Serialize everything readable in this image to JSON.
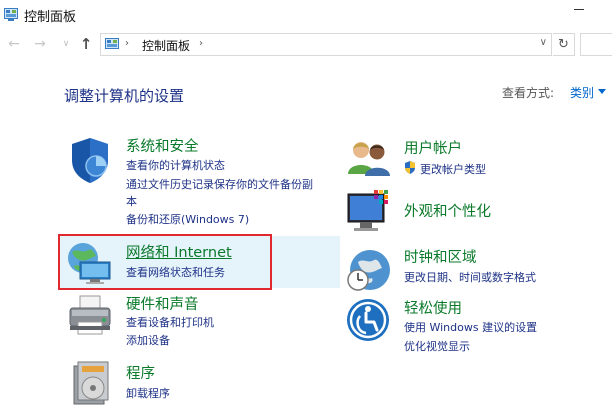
{
  "window": {
    "title": "控制面板"
  },
  "nav": {
    "back_glyph": "←",
    "forward_glyph": "→",
    "recent_glyph": "∨",
    "up_glyph": "↑",
    "breadcrumb_sep": "›",
    "address": "控制面板",
    "address_dropdown_glyph": "∨",
    "refresh_glyph": "↻"
  },
  "content": {
    "heading": "调整计算机的设置",
    "view_by_label": "查看方式:",
    "view_by_value": "类别"
  },
  "categories_left": [
    {
      "title": "系统和安全",
      "icon": "shield-icon",
      "links": [
        "查看你的计算机状态",
        "通过文件历史记录保存你的文件备份副",
        "本",
        "备份和还原(Windows 7)"
      ]
    },
    {
      "title": "网络和 Internet",
      "icon": "network-icon",
      "links": [
        "查看网络状态和任务"
      ]
    },
    {
      "title": "硬件和声音",
      "icon": "printer-icon",
      "links": [
        "查看设备和打印机",
        "添加设备"
      ]
    },
    {
      "title": "程序",
      "icon": "programs-icon",
      "links": [
        "卸载程序"
      ]
    }
  ],
  "categories_right": [
    {
      "title": "用户帐户",
      "icon": "users-icon",
      "links": [
        "更改帐户类型"
      ]
    },
    {
      "title": "外观和个性化",
      "icon": "appearance-icon",
      "links": []
    },
    {
      "title": "时钟和区域",
      "icon": "clock-globe-icon",
      "links": [
        "更改日期、时间或数字格式"
      ]
    },
    {
      "title": "轻松使用",
      "icon": "ease-of-access-icon",
      "links": [
        "使用 Windows 建议的设置",
        "优化视觉显示"
      ]
    }
  ],
  "colors": {
    "title_green": "#0a7a2a",
    "link_blue": "#1e3287",
    "highlight": "#e5f3fb",
    "annotation_red": "#e0282e"
  }
}
